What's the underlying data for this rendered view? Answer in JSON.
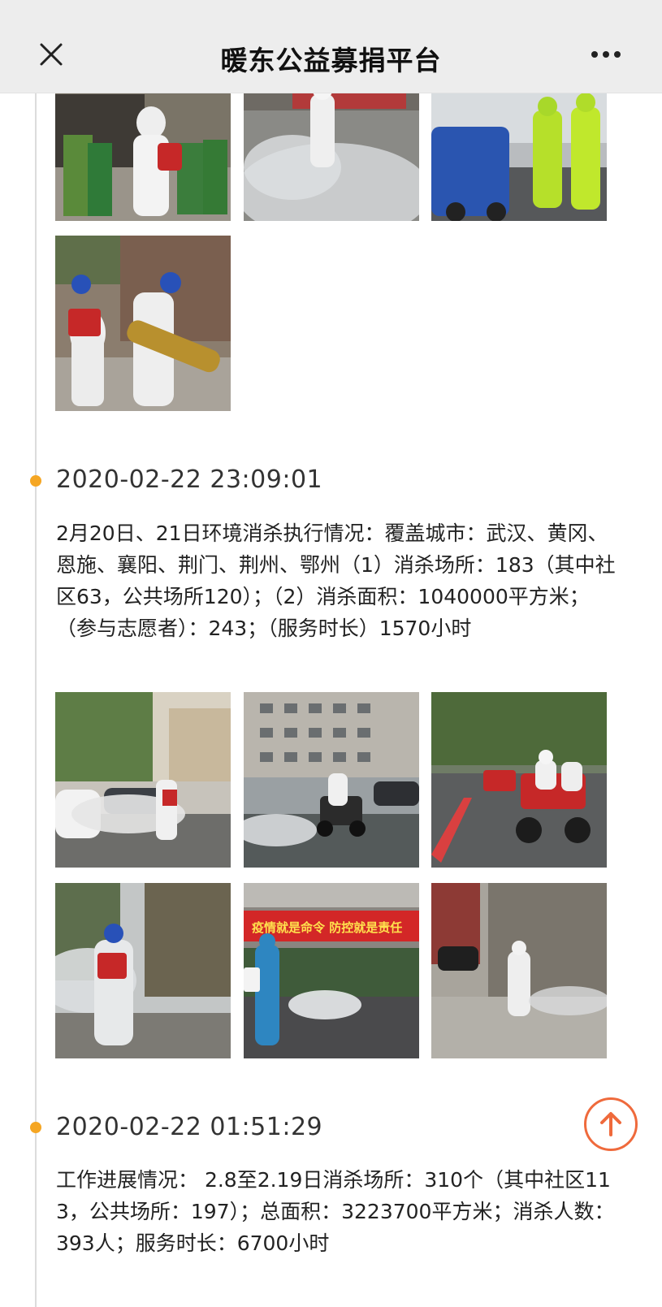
{
  "nav": {
    "title": "暖东公益募捐平台",
    "close_icon": "close-icon",
    "more_icon": "more-icon"
  },
  "posts": [
    {
      "photos": [
        {
          "icon": "photo-disinfection-garbage-bins"
        },
        {
          "icon": "photo-disinfection-fog-street"
        },
        {
          "icon": "photo-disinfection-green-suits"
        },
        {
          "icon": "photo-disinfection-volunteers-fogger"
        }
      ]
    },
    {
      "date": "2020-02-22 23:09:01",
      "text": "2月20日、21日环境消杀执行情况：覆盖城市：武汉、黄冈、恩施、襄阳、荆门、荆州、鄂州（1）消杀场所：183（其中社区63，公共场所120）；（2）消杀面积：1040000平方米；（参与志愿者）：243；（服务时长）1570小时",
      "photos": [
        {
          "icon": "photo-disinfection-parking-lot"
        },
        {
          "icon": "photo-disinfection-atv-building"
        },
        {
          "icon": "photo-disinfection-atv-road"
        },
        {
          "icon": "photo-disinfection-trees"
        },
        {
          "icon": "photo-disinfection-red-banner",
          "banner_text": "疫情就是命令  防控就是责任"
        },
        {
          "icon": "photo-disinfection-alley"
        }
      ]
    },
    {
      "date": "2020-02-22 01:51:29",
      "text": "工作进展情况： 2.8至2.19日消杀场所：310个（其中社区113，公共场所：197）；总面积：3223700平方米；消杀人数：393人；服务时长：6700小时"
    }
  ],
  "back_to_top": {
    "icon": "arrow-up-icon"
  },
  "colors": {
    "timeline_dot": "#f5a623",
    "back_to_top_accent": "#ef6a3c",
    "navbar_bg": "#ededed"
  }
}
